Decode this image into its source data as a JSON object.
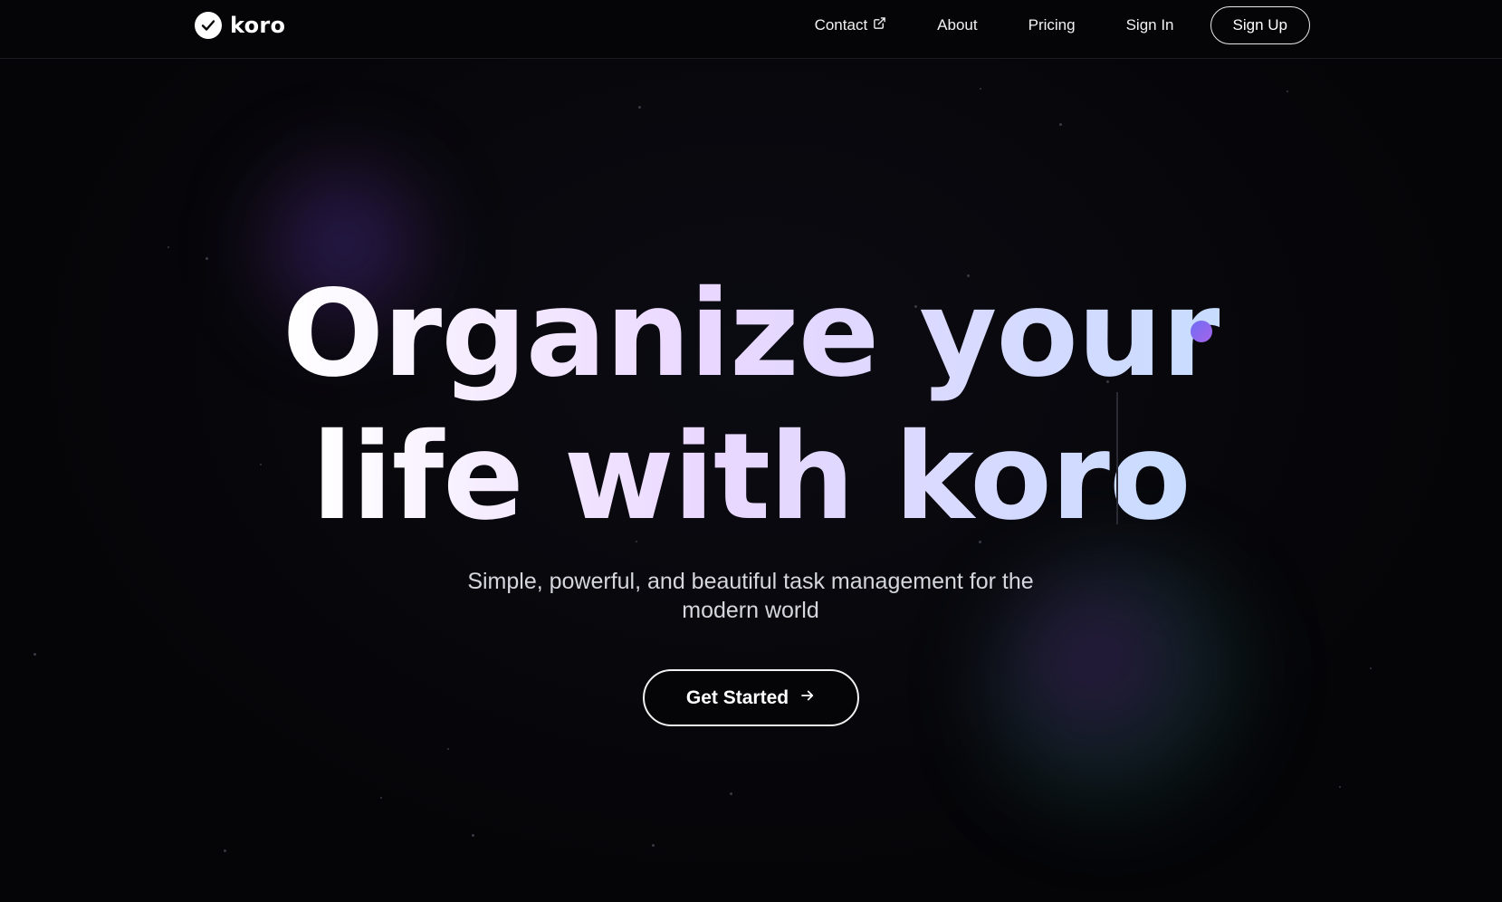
{
  "brand": {
    "name": "koro",
    "logo_icon": "check-circle-icon"
  },
  "nav": {
    "links": [
      {
        "label": "Contact",
        "icon": "external-link-icon"
      },
      {
        "label": "About"
      },
      {
        "label": "Pricing"
      },
      {
        "label": "Sign In"
      }
    ],
    "signup_label": "Sign Up"
  },
  "hero": {
    "headline_line1": "Organize your",
    "headline_line2": "life with koro",
    "subtitle": "Simple, powerful, and beautiful task management for the modern world",
    "cta_label": "Get Started",
    "cta_icon": "arrow-right-icon"
  },
  "colors": {
    "background": "#050508",
    "text": "#ffffff",
    "gradient_start": "#ffffff",
    "gradient_mid": "#ead7ff",
    "gradient_end": "#c8dcff",
    "accent_dot": "#8a68f0"
  }
}
